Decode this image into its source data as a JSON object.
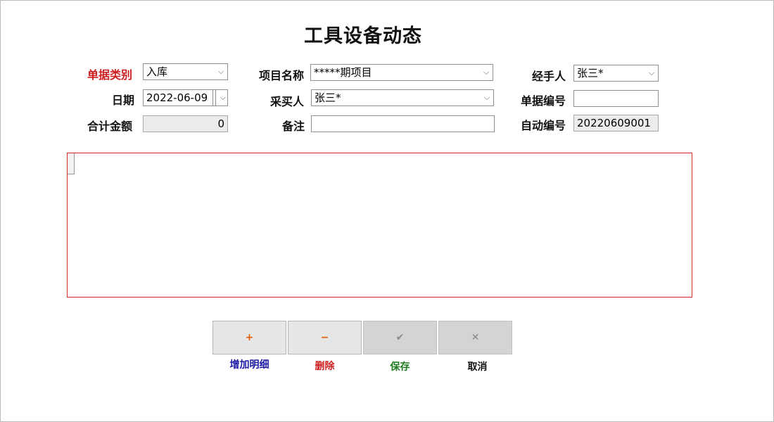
{
  "window": {
    "title": "工具设备动态"
  },
  "form": {
    "doc_type": {
      "label": "单据类别",
      "value": "入库"
    },
    "date": {
      "label": "日期",
      "value": "2022-06-09"
    },
    "total_amount": {
      "label": "合计金额",
      "value": "0"
    },
    "project_name": {
      "label": "项目名称",
      "value": "*****期项目"
    },
    "purchaser": {
      "label": "采买人",
      "value": "张三*"
    },
    "remarks": {
      "label": "备注",
      "value": ""
    },
    "handler": {
      "label": "经手人",
      "value": "张三*"
    },
    "doc_number": {
      "label": "单据编号",
      "value": ""
    },
    "auto_number": {
      "label": "自动编号",
      "value": "20220609001"
    }
  },
  "buttons": {
    "add": {
      "icon": "+",
      "label": "增加明细",
      "label_color": "#1a1aa6",
      "icon_color": "#e05a00"
    },
    "delete": {
      "icon": "−",
      "label": "删除",
      "label_color": "#cc1f1f",
      "icon_color": "#e05a00"
    },
    "save": {
      "icon": "✔",
      "label": "保存",
      "label_color": "#1d7a1d",
      "icon_color": "#888888"
    },
    "cancel": {
      "icon": "✕",
      "label": "取消",
      "label_color": "#111111",
      "icon_color": "#888888"
    }
  }
}
